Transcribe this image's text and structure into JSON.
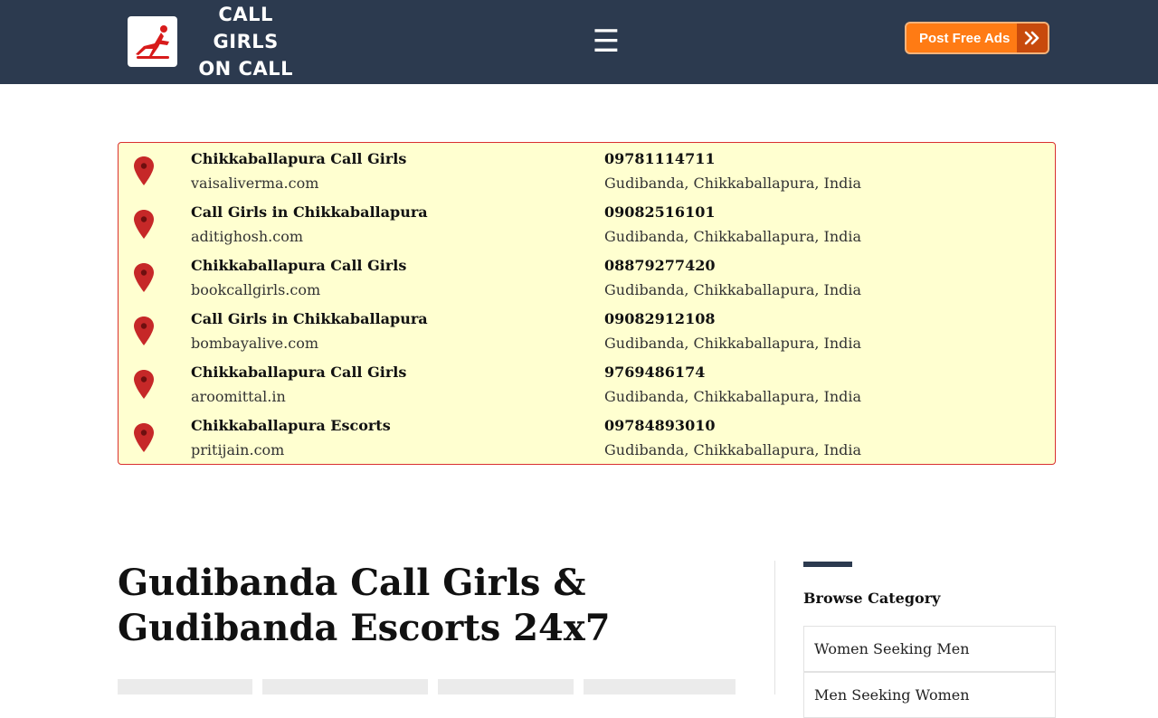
{
  "header": {
    "logo_line1": "CALL GIRLS",
    "logo_line2": "ON CALL",
    "menu_glyph": "☰",
    "post_ads_label": "Post Free Ads",
    "post_ads_icon": "double-chevron-right-icon"
  },
  "listings": [
    {
      "title": "Chikkaballapura Call Girls",
      "site": "vaisaliverma.com",
      "phone": "09781114711",
      "location": "Gudibanda, Chikkaballapura, India"
    },
    {
      "title": "Call Girls in Chikkaballapura",
      "site": "aditighosh.com",
      "phone": "09082516101",
      "location": "Gudibanda, Chikkaballapura, India"
    },
    {
      "title": "Chikkaballapura Call Girls",
      "site": "bookcallgirls.com",
      "phone": "08879277420",
      "location": "Gudibanda, Chikkaballapura, India"
    },
    {
      "title": "Call Girls in Chikkaballapura",
      "site": "bombayalive.com",
      "phone": "09082912108",
      "location": "Gudibanda, Chikkaballapura, India"
    },
    {
      "title": "Chikkaballapura Call Girls",
      "site": "aroomittal.in",
      "phone": "9769486174",
      "location": "Gudibanda, Chikkaballapura, India"
    },
    {
      "title": "Chikkaballapura Escorts",
      "site": "pritijain.com",
      "phone": "09784893010",
      "location": "Gudibanda, Chikkaballapura, India"
    }
  ],
  "main": {
    "title": "Gudibanda Call Girls & Gudibanda Escorts 24x7"
  },
  "sidebar": {
    "heading": "Browse Category",
    "categories": [
      "Women Seeking Men",
      "Men Seeking Women"
    ]
  },
  "colors": {
    "header_bg": "#2c3a4f",
    "accent_orange": "#ff7b14",
    "listing_bg": "#ffffd0",
    "listing_border": "#d93030",
    "pin_red": "#c62828"
  }
}
